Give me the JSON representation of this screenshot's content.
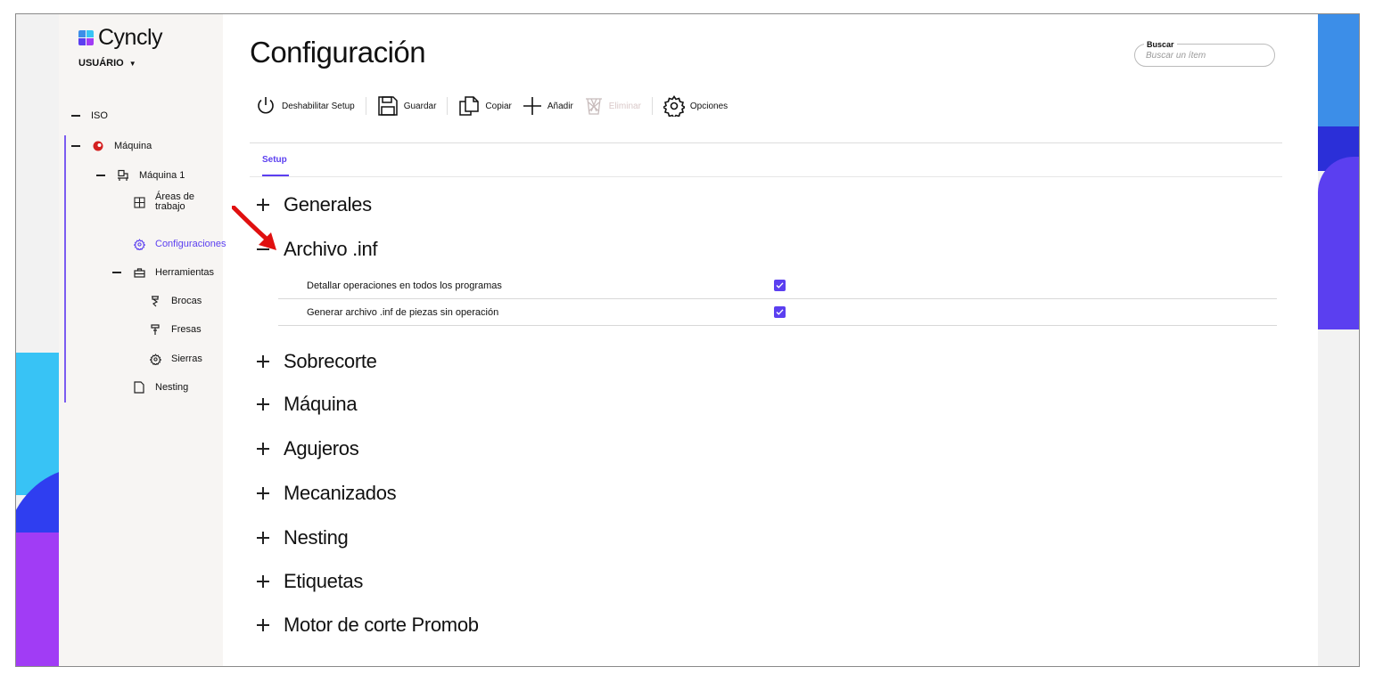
{
  "brand": {
    "name": "Cyncly",
    "logo_colors": [
      "#3c8ee8",
      "#5b3ff0",
      "#38c3f5",
      "#a13cf5"
    ]
  },
  "user": {
    "label": "USUÁRIO"
  },
  "sidebar": {
    "items": [
      {
        "label": "ISO",
        "icon": "minus-icon"
      },
      {
        "label": "Máquina",
        "icon": "machine-red-icon"
      },
      {
        "label": "Máquina 1",
        "icon": "machine-icon"
      },
      {
        "label": "Áreas de trabajo",
        "icon": "grid-icon"
      },
      {
        "label": "Configuraciones",
        "icon": "gear-icon",
        "active": true
      },
      {
        "label": "Herramientas",
        "icon": "toolbox-icon"
      },
      {
        "label": "Brocas",
        "icon": "drill-icon"
      },
      {
        "label": "Fresas",
        "icon": "mill-icon"
      },
      {
        "label": "Sierras",
        "icon": "saw-icon"
      },
      {
        "label": "Nesting",
        "icon": "document-icon"
      }
    ]
  },
  "page": {
    "title": "Configuración"
  },
  "search": {
    "label": "Buscar",
    "placeholder": "Buscar un ítem"
  },
  "toolbar": {
    "disable_setup": "Deshabilitar Setup",
    "save": "Guardar",
    "copy": "Copiar",
    "add": "Añadir",
    "delete": "Eliminar",
    "options": "Opciones"
  },
  "tabs": [
    {
      "label": "Setup",
      "active": true
    }
  ],
  "sections": [
    {
      "label": "Generales",
      "expanded": false
    },
    {
      "label": "Archivo .inf",
      "expanded": true,
      "options": [
        {
          "label": "Detallar operaciones en todos los programas",
          "checked": true
        },
        {
          "label": "Generar archivo .inf de piezas sin operación",
          "checked": true
        }
      ]
    },
    {
      "label": "Sobrecorte",
      "expanded": false
    },
    {
      "label": "Máquina",
      "expanded": false
    },
    {
      "label": "Agujeros",
      "expanded": false
    },
    {
      "label": "Mecanizados",
      "expanded": false
    },
    {
      "label": "Nesting",
      "expanded": false
    },
    {
      "label": "Etiquetas",
      "expanded": false
    },
    {
      "label": "Motor de corte Promob",
      "expanded": false
    }
  ],
  "colors": {
    "accent": "#5b3ff0",
    "annotation_arrow": "#e01010"
  }
}
